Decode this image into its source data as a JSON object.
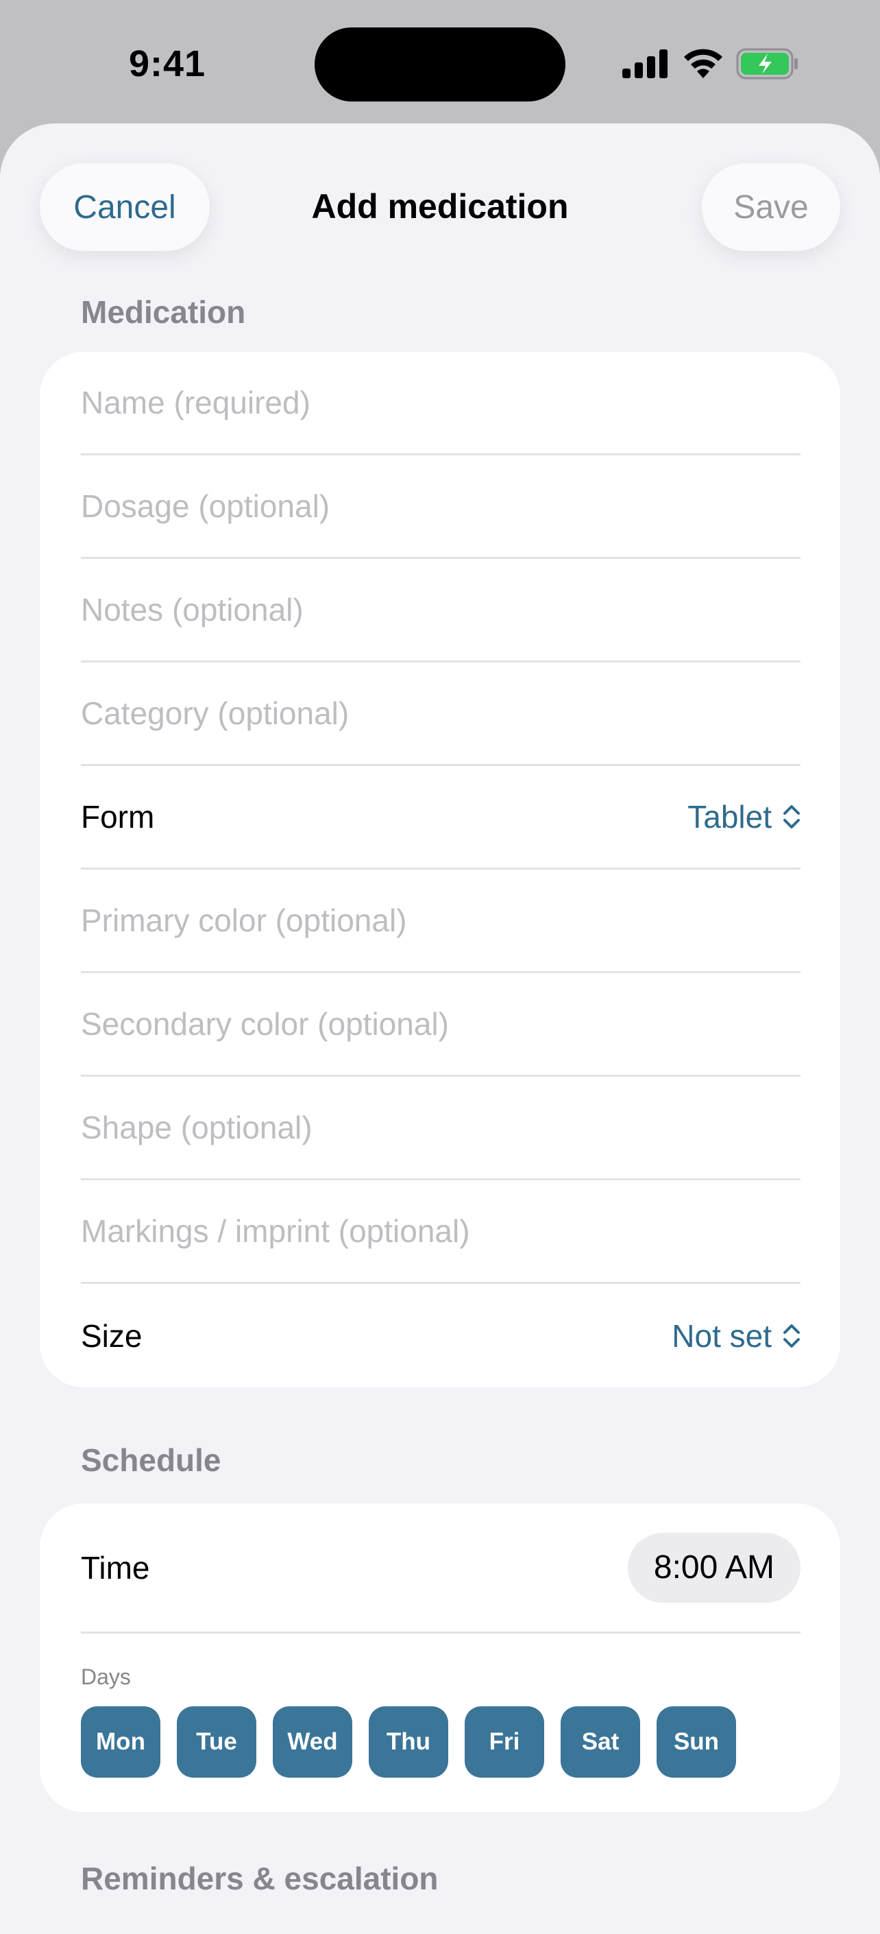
{
  "status_bar": {
    "time": "9:41"
  },
  "header": {
    "cancel_label": "Cancel",
    "title": "Add medication",
    "save_label": "Save"
  },
  "sections": {
    "medication": "Medication",
    "schedule": "Schedule",
    "reminders": "Reminders & escalation"
  },
  "medication": {
    "name_placeholder": "Name (required)",
    "dosage_placeholder": "Dosage (optional)",
    "notes_placeholder": "Notes (optional)",
    "category_placeholder": "Category (optional)",
    "form_label": "Form",
    "form_value": "Tablet",
    "primary_color_placeholder": "Primary color (optional)",
    "secondary_color_placeholder": "Secondary color (optional)",
    "shape_placeholder": "Shape (optional)",
    "markings_placeholder": "Markings / imprint (optional)",
    "size_label": "Size",
    "size_value": "Not set"
  },
  "schedule": {
    "time_label": "Time",
    "time_value": "8:00 AM",
    "days_label": "Days",
    "days": [
      "Mon",
      "Tue",
      "Wed",
      "Thu",
      "Fri",
      "Sat",
      "Sun"
    ]
  },
  "colors": {
    "accent": "#2f6a8d",
    "day_chip": "#3b7598",
    "battery": "#34c759"
  },
  "icons": {
    "signal": "cellular-signal-icon",
    "wifi": "wifi-icon",
    "battery": "battery-charging-icon",
    "picker": "chevron-up-down-icon"
  }
}
